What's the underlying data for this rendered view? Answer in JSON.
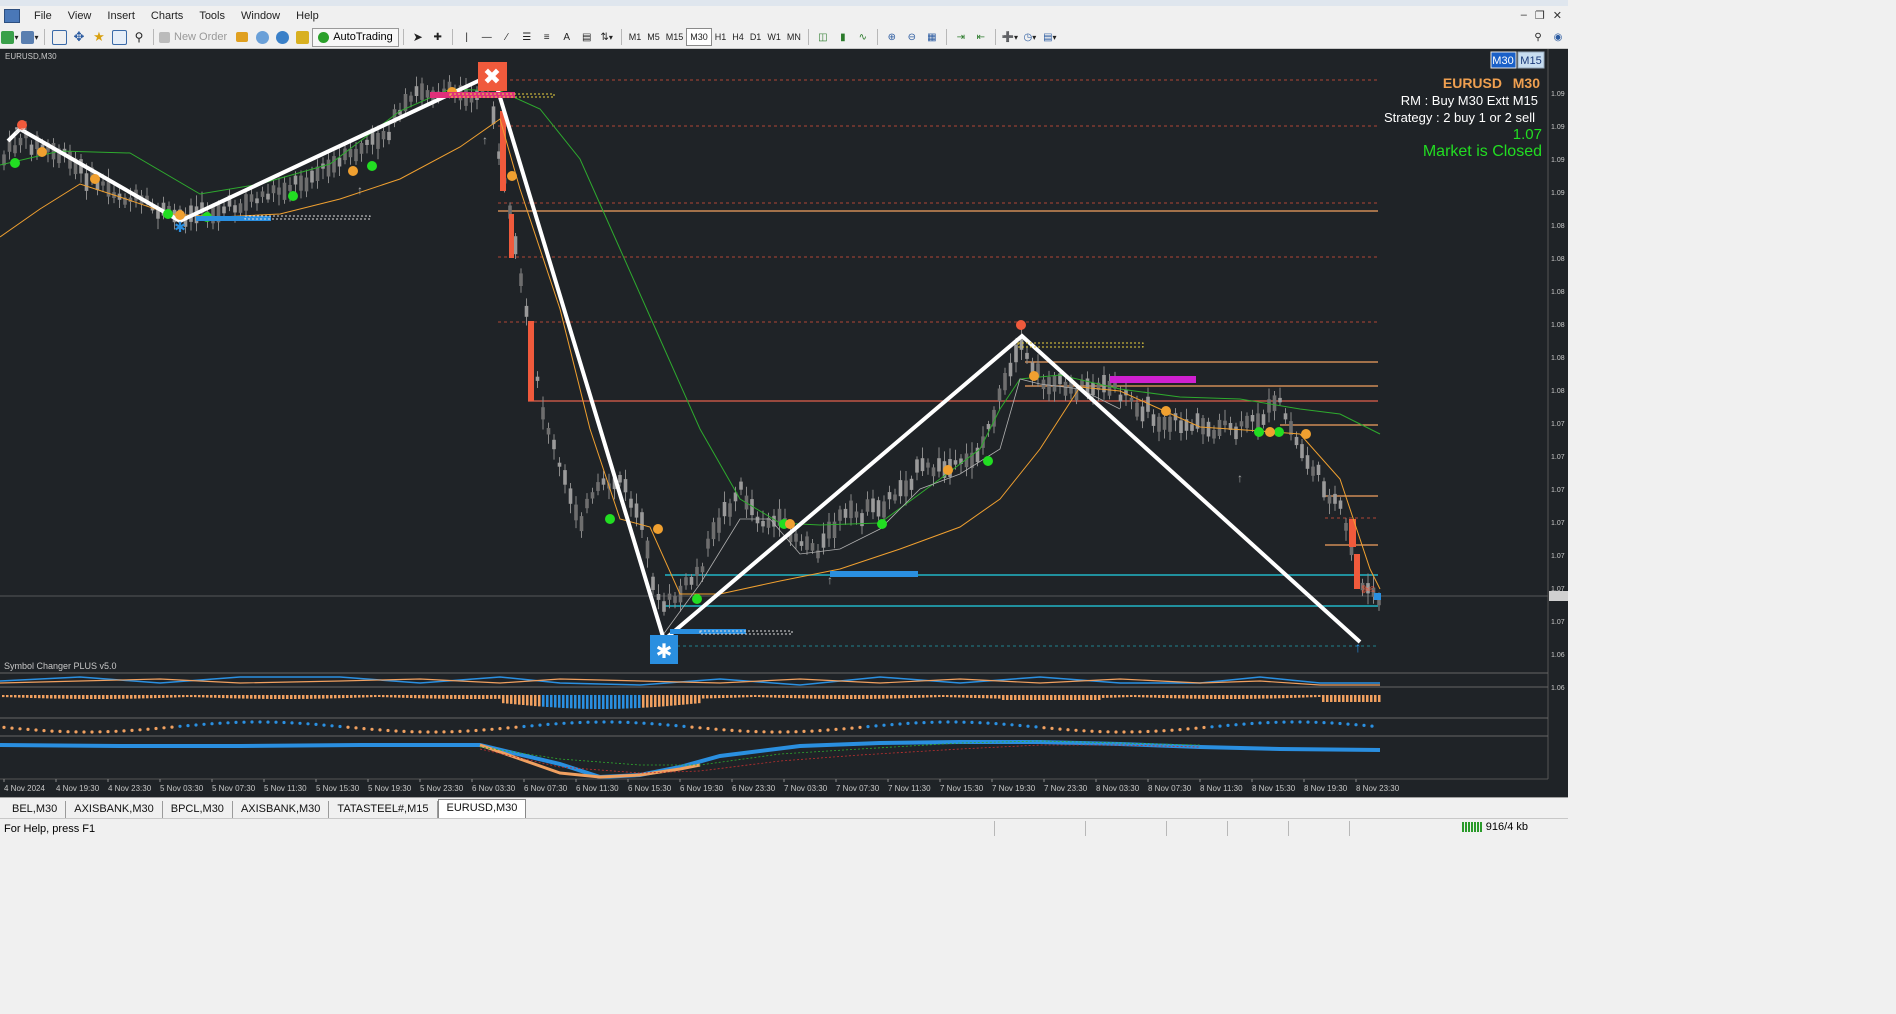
{
  "menu": [
    "File",
    "View",
    "Insert",
    "Charts",
    "Tools",
    "Window",
    "Help"
  ],
  "toolbar": {
    "new_order": "New Order",
    "autotrading": "AutoTrading",
    "timeframes": [
      "M1",
      "M5",
      "M15",
      "M30",
      "H1",
      "H4",
      "D1",
      "W1",
      "MN"
    ],
    "active_timeframe": "M30"
  },
  "chart": {
    "window_label": "EURUSD,M30",
    "tf_buttons": [
      "M30",
      "M15"
    ],
    "overlay": {
      "symbol": "EURUSD",
      "tf": "M30",
      "rm_line": "RM : Buy M30 Extt M15",
      "strategy_line": "Strategy : 2 buy  1 or 2 sell",
      "value": "1.07",
      "market_status": "Market is Closed"
    },
    "indicator_label": "Symbol Changer PLUS v5.0",
    "price_scale": [
      "1.09",
      "1.09",
      "1.09",
      "1.09",
      "1.08",
      "1.08",
      "1.08",
      "1.08",
      "1.08",
      "1.08",
      "1.07",
      "1.07",
      "1.07",
      "1.07",
      "1.07",
      "1.07",
      "1.07",
      "1.06",
      "1.06"
    ],
    "time_axis": [
      "4 Nov 2024",
      "4 Nov 19:30",
      "4 Nov 23:30",
      "5 Nov 03:30",
      "5 Nov 07:30",
      "5 Nov 11:30",
      "5 Nov 15:30",
      "5 Nov 19:30",
      "5 Nov 23:30",
      "6 Nov 03:30",
      "6 Nov 07:30",
      "6 Nov 11:30",
      "6 Nov 15:30",
      "6 Nov 19:30",
      "6 Nov 23:30",
      "7 Nov 03:30",
      "7 Nov 07:30",
      "7 Nov 11:30",
      "7 Nov 15:30",
      "7 Nov 19:30",
      "7 Nov 23:30",
      "8 Nov 03:30",
      "8 Nov 07:30",
      "8 Nov 11:30",
      "8 Nov 15:30",
      "8 Nov 19:30",
      "8 Nov 23:30"
    ]
  },
  "tabs": [
    "BEL,M30",
    "AXISBANK,M30",
    "BPCL,M30",
    "AXISBANK,M30",
    "TATASTEEL#,M15",
    "EURUSD,M30"
  ],
  "active_tab": "EURUSD,M30",
  "status": {
    "help": "For Help, press F1",
    "traffic": "916/4 kb"
  },
  "colors": {
    "chart_bg": "#1f2327",
    "buy_marker": "#2a8fe0",
    "sell_marker": "#f05a3c",
    "zigzag": "#ffffff",
    "overlay_title": "#f0a050",
    "market_closed": "#22dd22"
  }
}
